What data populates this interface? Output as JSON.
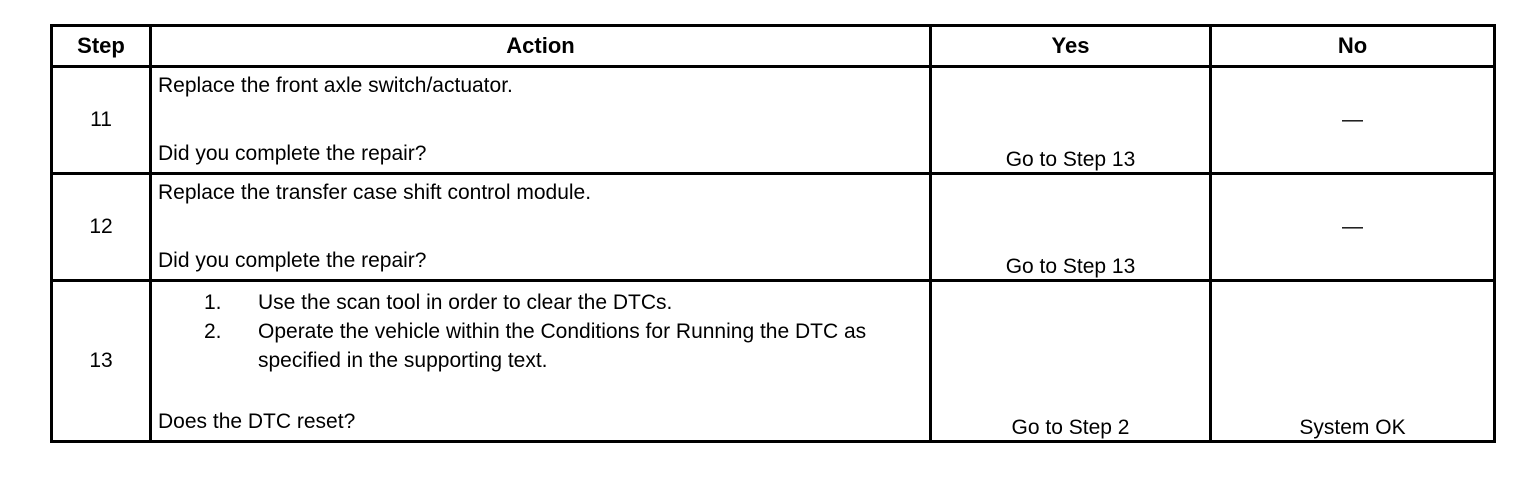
{
  "table": {
    "headers": {
      "step": "Step",
      "action": "Action",
      "yes": "Yes",
      "no": "No"
    },
    "rows": [
      {
        "step": "11",
        "action_text": "Replace the front axle switch/actuator.",
        "question": "Did you complete the repair?",
        "yes": "Go to Step 13",
        "no": "—"
      },
      {
        "step": "12",
        "action_text": "Replace the transfer case shift control module.",
        "question": "Did you complete the repair?",
        "yes": "Go to Step 13",
        "no": "—"
      },
      {
        "step": "13",
        "action_list": [
          {
            "num": "1.",
            "text": "Use the scan tool in order to clear the DTCs."
          },
          {
            "num": "2.",
            "text": "Operate the vehicle within the Conditions for Running the DTC as specified in the supporting text."
          }
        ],
        "question": "Does the DTC reset?",
        "yes": "Go to Step 2",
        "no": "System OK"
      }
    ]
  }
}
